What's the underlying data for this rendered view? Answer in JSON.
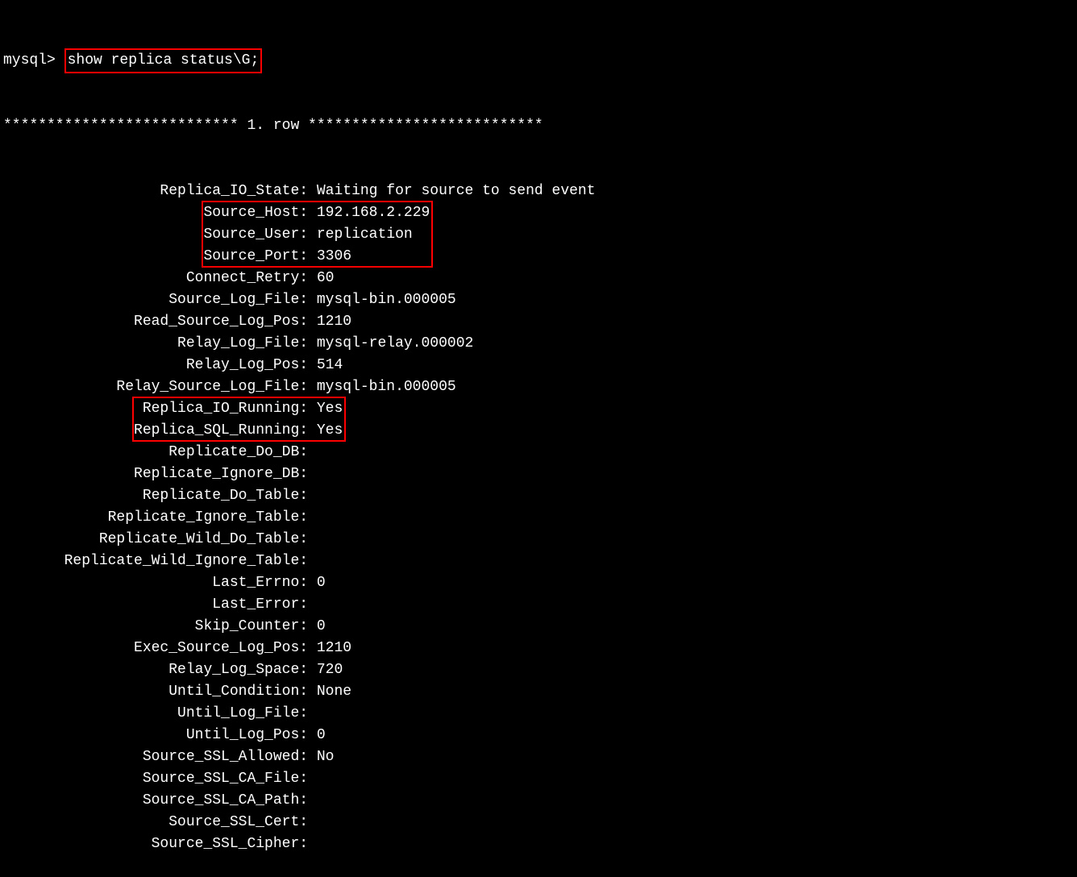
{
  "prompt": "mysql>",
  "command": "show replica status\\G;",
  "row_header": "*************************** 1. row ***************************",
  "fields": [
    {
      "label": "Replica_IO_State",
      "value": "Waiting for source to send event",
      "group": 0
    },
    {
      "label": "Source_Host",
      "value": "192.168.2.229",
      "group": 1
    },
    {
      "label": "Source_User",
      "value": "replication",
      "group": 1
    },
    {
      "label": "Source_Port",
      "value": "3306",
      "group": 1
    },
    {
      "label": "Connect_Retry",
      "value": "60",
      "group": 0
    },
    {
      "label": "Source_Log_File",
      "value": "mysql-bin.000005",
      "group": 0
    },
    {
      "label": "Read_Source_Log_Pos",
      "value": "1210",
      "group": 0
    },
    {
      "label": "Relay_Log_File",
      "value": "mysql-relay.000002",
      "group": 0
    },
    {
      "label": "Relay_Log_Pos",
      "value": "514",
      "group": 0
    },
    {
      "label": "Relay_Source_Log_File",
      "value": "mysql-bin.000005",
      "group": 0
    },
    {
      "label": "Replica_IO_Running",
      "value": "Yes",
      "group": 2
    },
    {
      "label": "Replica_SQL_Running",
      "value": "Yes",
      "group": 2
    },
    {
      "label": "Replicate_Do_DB",
      "value": "",
      "group": 0
    },
    {
      "label": "Replicate_Ignore_DB",
      "value": "",
      "group": 0
    },
    {
      "label": "Replicate_Do_Table",
      "value": "",
      "group": 0
    },
    {
      "label": "Replicate_Ignore_Table",
      "value": "",
      "group": 0
    },
    {
      "label": "Replicate_Wild_Do_Table",
      "value": "",
      "group": 0
    },
    {
      "label": "Replicate_Wild_Ignore_Table",
      "value": "",
      "group": 0
    },
    {
      "label": "Last_Errno",
      "value": "0",
      "group": 0
    },
    {
      "label": "Last_Error",
      "value": "",
      "group": 0
    },
    {
      "label": "Skip_Counter",
      "value": "0",
      "group": 0
    },
    {
      "label": "Exec_Source_Log_Pos",
      "value": "1210",
      "group": 0
    },
    {
      "label": "Relay_Log_Space",
      "value": "720",
      "group": 0
    },
    {
      "label": "Until_Condition",
      "value": "None",
      "group": 0
    },
    {
      "label": "Until_Log_File",
      "value": "",
      "group": 0
    },
    {
      "label": "Until_Log_Pos",
      "value": "0",
      "group": 0
    },
    {
      "label": "Source_SSL_Allowed",
      "value": "No",
      "group": 0
    },
    {
      "label": "Source_SSL_CA_File",
      "value": "",
      "group": 0
    },
    {
      "label": "Source_SSL_CA_Path",
      "value": "",
      "group": 0
    },
    {
      "label": "Source_SSL_Cert",
      "value": "",
      "group": 0
    },
    {
      "label": "Source_SSL_Cipher",
      "value": "",
      "group": 0
    }
  ]
}
